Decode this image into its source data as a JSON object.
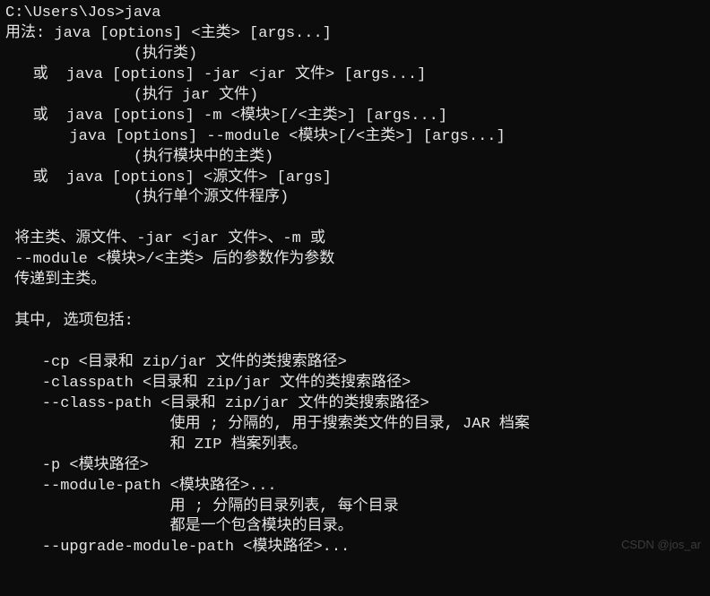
{
  "terminal": {
    "lines": [
      "C:\\Users\\Jos>java",
      "用法: java [options] <主类> [args...]",
      "              (执行类)",
      "   或  java [options] -jar <jar 文件> [args...]",
      "              (执行 jar 文件)",
      "   或  java [options] -m <模块>[/<主类>] [args...]",
      "       java [options] --module <模块>[/<主类>] [args...]",
      "              (执行模块中的主类)",
      "   或  java [options] <源文件> [args]",
      "              (执行单个源文件程序)",
      "",
      " 将主类、源文件、-jar <jar 文件>、-m 或",
      " --module <模块>/<主类> 后的参数作为参数",
      " 传递到主类。",
      "",
      " 其中, 选项包括:",
      "",
      "    -cp <目录和 zip/jar 文件的类搜索路径>",
      "    -classpath <目录和 zip/jar 文件的类搜索路径>",
      "    --class-path <目录和 zip/jar 文件的类搜索路径>",
      "                  使用 ; 分隔的, 用于搜索类文件的目录, JAR 档案",
      "                  和 ZIP 档案列表。",
      "    -p <模块路径>",
      "    --module-path <模块路径>...",
      "                  用 ; 分隔的目录列表, 每个目录",
      "                  都是一个包含模块的目录。",
      "    --upgrade-module-path <模块路径>..."
    ]
  },
  "watermark": {
    "text": "CSDN @jos_ar"
  }
}
